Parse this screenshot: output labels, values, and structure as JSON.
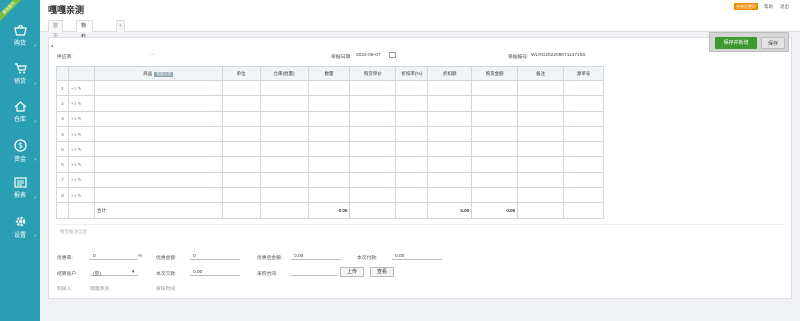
{
  "app": {
    "title": "嘎嘎亲测",
    "ribbon": "最佳服务"
  },
  "sidebar": {
    "items": [
      {
        "label": "购货",
        "icon": "basket-icon"
      },
      {
        "label": "销货",
        "icon": "cart-icon"
      },
      {
        "label": "仓库",
        "icon": "home-icon"
      },
      {
        "label": "资金",
        "icon": "dollar-icon"
      },
      {
        "label": "报表",
        "icon": "report-icon"
      },
      {
        "label": "设置",
        "icon": "gear-icon"
      }
    ],
    "arrow": "›"
  },
  "tabs": [
    {
      "label": "首页"
    },
    {
      "label": "物料预购",
      "close": "×"
    }
  ],
  "tabs_add": "+",
  "topright": {
    "badge": "系统设置好",
    "links": [
      "帮助",
      "退出"
    ]
  },
  "actions": {
    "save_new": "保存并新增",
    "save": "保存"
  },
  "form": {
    "supplier_label": "供应商:",
    "supplier_value": "···",
    "date_label": "单据日期:",
    "date_value": "2022-09-07",
    "bill_label": "单据编号:",
    "bill_value": "WLRG20220907114716S"
  },
  "table": {
    "headers": [
      "",
      "",
      "商品",
      "单位",
      "仓库(批量)",
      "数量",
      "购货单价",
      "折扣率(%)",
      "折扣额",
      "购货金额",
      "备注",
      "源单号"
    ],
    "batch_btn": "批量添加",
    "rows": [
      {
        "n": "1",
        "ops": "+ ≡ ✎"
      },
      {
        "n": "2",
        "ops": "+ ≡ ✎"
      },
      {
        "n": "3",
        "ops": "+ ≡ ✎"
      },
      {
        "n": "4",
        "ops": "+ ≡ ✎"
      },
      {
        "n": "5",
        "ops": "+ ≡ ✎"
      },
      {
        "n": "6",
        "ops": "+ ≡ ✎"
      },
      {
        "n": "7",
        "ops": "+ ≡ ✎"
      },
      {
        "n": "8",
        "ops": "+ ≡ ✎"
      }
    ],
    "total_label": "合计:",
    "total_qty": "0.00",
    "total_discount": "0.00",
    "total_amount": "0.00"
  },
  "memo_placeholder": "暂无备注信息",
  "footer": {
    "discount_rate_label": "优惠率:",
    "discount_rate_value": "0",
    "pct": "%",
    "discount_amt_label": "优惠金额:",
    "discount_amt_value": "0",
    "after_discount_label": "优惠后金额:",
    "after_discount_value": "0.00",
    "paid_label": "本次付款:",
    "paid_value": "0.00",
    "account_label": "结算账户:",
    "account_value": "(空)",
    "account_caret": "▾",
    "arrears_label": "本次欠款:",
    "arrears_value": "0.00",
    "contract_label": "采购合同:",
    "upload_btn": "上传",
    "view_btn": "查看",
    "creator_label": "制单人:",
    "creator_value": "嘎嘎亲测",
    "audit_label": "审核时间:"
  }
}
